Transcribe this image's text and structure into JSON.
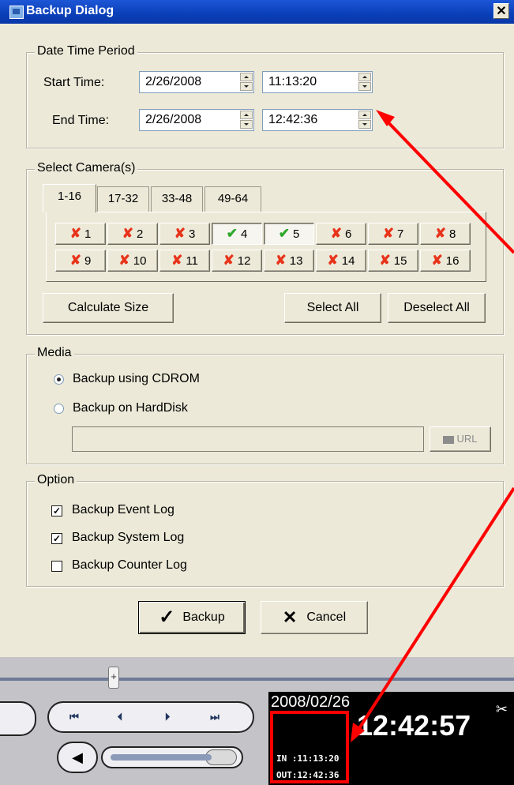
{
  "window": {
    "title": "Backup Dialog",
    "close_glyph": "✕"
  },
  "date_time": {
    "legend": "Date Time Period",
    "start_label": "Start Time:",
    "start_date": "2/26/2008",
    "start_time": "11:13:20",
    "end_label": "End Time:",
    "end_date": "2/26/2008",
    "end_time": "12:42:36"
  },
  "cameras": {
    "legend": "Select Camera(s)",
    "tabs": [
      "1-16",
      "17-32",
      "33-48",
      "49-64"
    ],
    "active_tab": "1-16",
    "items": [
      {
        "num": "1",
        "selected": false
      },
      {
        "num": "2",
        "selected": false
      },
      {
        "num": "3",
        "selected": false
      },
      {
        "num": "4",
        "selected": true
      },
      {
        "num": "5",
        "selected": true
      },
      {
        "num": "6",
        "selected": false
      },
      {
        "num": "7",
        "selected": false
      },
      {
        "num": "8",
        "selected": false
      },
      {
        "num": "9",
        "selected": false
      },
      {
        "num": "10",
        "selected": false
      },
      {
        "num": "11",
        "selected": false
      },
      {
        "num": "12",
        "selected": false
      },
      {
        "num": "13",
        "selected": false
      },
      {
        "num": "14",
        "selected": false
      },
      {
        "num": "15",
        "selected": false
      },
      {
        "num": "16",
        "selected": false
      }
    ],
    "calculate_label": "Calculate Size",
    "select_all_label": "Select All",
    "deselect_all_label": "Deselect All"
  },
  "media": {
    "legend": "Media",
    "cdrom_label": "Backup using CDROM",
    "harddisk_label": "Backup on HardDisk",
    "selected": "cdrom",
    "path_value": "",
    "url_label": "URL"
  },
  "option": {
    "legend": "Option",
    "event_log_label": "Backup Event Log",
    "event_log_checked": true,
    "system_log_label": "Backup System Log",
    "system_log_checked": true,
    "counter_log_label": "Backup Counter Log",
    "counter_log_checked": false
  },
  "actions": {
    "backup_label": "Backup",
    "cancel_label": "Cancel"
  },
  "player": {
    "date": "2008/02/26",
    "time": "12:42:57",
    "in_text": "IN :11:13:20",
    "out_text": "OUT:12:42:36",
    "buttons": [
      "⏮",
      "⏴",
      "⏵",
      "⏭"
    ]
  },
  "colors": {
    "annotation": "#ff0000",
    "title_bar": "#0a3fb8",
    "dialog_bg": "#ece9d8"
  }
}
